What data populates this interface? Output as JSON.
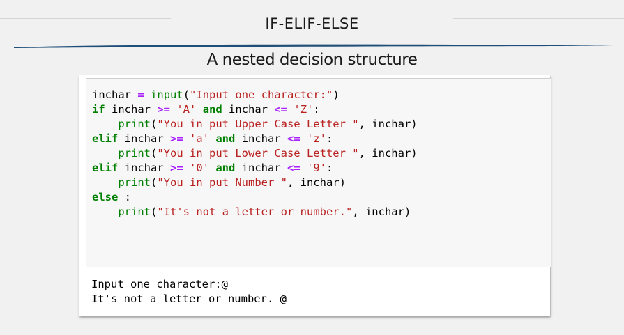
{
  "slide": {
    "title": "IF-ELIF-ELSE",
    "subtitle": "A nested decision structure"
  },
  "code_cell": {
    "lines": [
      [
        {
          "t": "inchar",
          "c": ""
        },
        {
          "t": " ",
          "c": ""
        },
        {
          "t": "=",
          "c": "op"
        },
        {
          "t": " ",
          "c": ""
        },
        {
          "t": "input",
          "c": "fn"
        },
        {
          "t": "(",
          "c": ""
        },
        {
          "t": "\"Input one character:\"",
          "c": "str"
        },
        {
          "t": ")",
          "c": ""
        }
      ],
      [
        {
          "t": "if",
          "c": "kw"
        },
        {
          "t": " inchar ",
          "c": ""
        },
        {
          "t": ">=",
          "c": "op"
        },
        {
          "t": " ",
          "c": ""
        },
        {
          "t": "'A'",
          "c": "str"
        },
        {
          "t": " ",
          "c": ""
        },
        {
          "t": "and",
          "c": "kw"
        },
        {
          "t": " inchar ",
          "c": ""
        },
        {
          "t": "<=",
          "c": "op"
        },
        {
          "t": " ",
          "c": ""
        },
        {
          "t": "'Z'",
          "c": "str"
        },
        {
          "t": ":",
          "c": ""
        }
      ],
      [
        {
          "t": "    ",
          "c": ""
        },
        {
          "t": "print",
          "c": "fn"
        },
        {
          "t": "(",
          "c": ""
        },
        {
          "t": "\"You in put Upper Case Letter \"",
          "c": "str"
        },
        {
          "t": ", inchar)",
          "c": ""
        }
      ],
      [
        {
          "t": "elif",
          "c": "kw"
        },
        {
          "t": " inchar ",
          "c": ""
        },
        {
          "t": ">=",
          "c": "op"
        },
        {
          "t": " ",
          "c": ""
        },
        {
          "t": "'a'",
          "c": "str"
        },
        {
          "t": " ",
          "c": ""
        },
        {
          "t": "and",
          "c": "kw"
        },
        {
          "t": " inchar ",
          "c": ""
        },
        {
          "t": "<=",
          "c": "op"
        },
        {
          "t": " ",
          "c": ""
        },
        {
          "t": "'z'",
          "c": "str"
        },
        {
          "t": ":",
          "c": ""
        }
      ],
      [
        {
          "t": "    ",
          "c": ""
        },
        {
          "t": "print",
          "c": "fn"
        },
        {
          "t": "(",
          "c": ""
        },
        {
          "t": "\"You in put Lower Case Letter \"",
          "c": "str"
        },
        {
          "t": ", inchar)",
          "c": ""
        }
      ],
      [
        {
          "t": "elif",
          "c": "kw"
        },
        {
          "t": " inchar ",
          "c": ""
        },
        {
          "t": ">=",
          "c": "op"
        },
        {
          "t": " ",
          "c": ""
        },
        {
          "t": "'0'",
          "c": "str"
        },
        {
          "t": " ",
          "c": ""
        },
        {
          "t": "and",
          "c": "kw"
        },
        {
          "t": " inchar ",
          "c": ""
        },
        {
          "t": "<=",
          "c": "op"
        },
        {
          "t": " ",
          "c": ""
        },
        {
          "t": "'9'",
          "c": "str"
        },
        {
          "t": ":",
          "c": ""
        }
      ],
      [
        {
          "t": "    ",
          "c": ""
        },
        {
          "t": "print",
          "c": "fn"
        },
        {
          "t": "(",
          "c": ""
        },
        {
          "t": "\"You in put Number \"",
          "c": "str"
        },
        {
          "t": ", inchar)",
          "c": ""
        }
      ],
      [
        {
          "t": "else",
          "c": "kw"
        },
        {
          "t": " :",
          "c": ""
        }
      ],
      [
        {
          "t": "    ",
          "c": ""
        },
        {
          "t": "print",
          "c": "fn"
        },
        {
          "t": "(",
          "c": ""
        },
        {
          "t": "\"It's not a letter or number.\"",
          "c": "str"
        },
        {
          "t": ", inchar)",
          "c": ""
        }
      ]
    ]
  },
  "output": {
    "lines": [
      "Input one character:@",
      "It's not a letter or number. @"
    ]
  },
  "colors": {
    "keyword": "#008000",
    "operator": "#aa22ff",
    "string": "#ba2121",
    "swoosh": "#1f4e79"
  }
}
